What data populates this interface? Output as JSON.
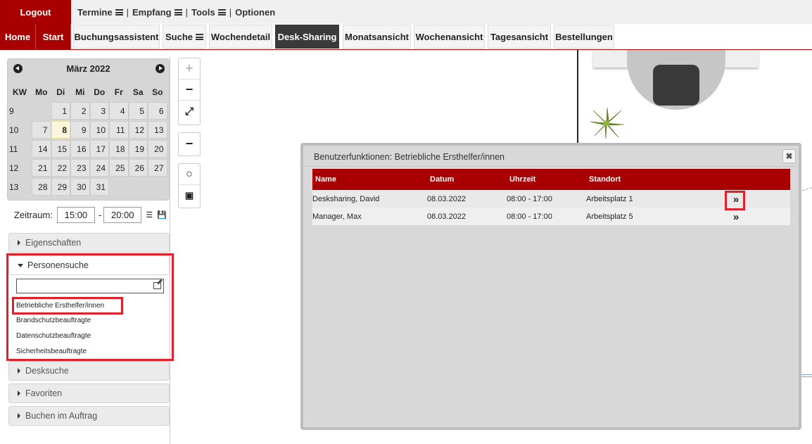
{
  "topbar": {
    "logout": "Logout",
    "menu": [
      {
        "label": "Termine"
      },
      {
        "label": "Empfang"
      },
      {
        "label": "Tools"
      },
      {
        "label": "Optionen"
      }
    ],
    "separator": "|"
  },
  "nav": {
    "home": "Home",
    "start": "Start",
    "tabs": [
      "Buchungsassistent",
      "Suche",
      "Wochendetail",
      "Desk-Sharing",
      "Monatsansicht",
      "Wochenansicht",
      "Tagesansicht",
      "Bestellungen"
    ],
    "active_tab": "Desk-Sharing"
  },
  "calendar": {
    "month_title": "März 2022",
    "headers": [
      "KW",
      "Mo",
      "Di",
      "Mi",
      "Do",
      "Fr",
      "Sa",
      "So"
    ],
    "weeks": [
      {
        "kw": "9",
        "days": [
          "",
          "1",
          "2",
          "3",
          "4",
          "5",
          "6"
        ]
      },
      {
        "kw": "10",
        "days": [
          "7",
          "8",
          "9",
          "10",
          "11",
          "12",
          "13"
        ]
      },
      {
        "kw": "11",
        "days": [
          "14",
          "15",
          "16",
          "17",
          "18",
          "19",
          "20"
        ]
      },
      {
        "kw": "12",
        "days": [
          "21",
          "22",
          "23",
          "24",
          "25",
          "26",
          "27"
        ]
      },
      {
        "kw": "13",
        "days": [
          "28",
          "29",
          "30",
          "31",
          "",
          "",
          ""
        ]
      }
    ],
    "today": "8"
  },
  "zeitraum": {
    "label": "Zeitraum:",
    "from": "15:00",
    "to": "20:00",
    "dash": "-"
  },
  "sidebar": {
    "eigenschaften": "Eigenschaften",
    "personensuche": "Personensuche",
    "person_links": [
      "Betriebliche Ersthelfer/innen",
      "Brandschutzbeauftragte",
      "Datenschutzbeauftragte",
      "Sicherheitsbeauftragte"
    ],
    "desksuche": "Desksuche",
    "favoriten": "Favoriten",
    "buchen_im_auftrag": "Buchen im Auftrag"
  },
  "dialog": {
    "title": "Benutzerfunktionen: Betriebliche Ersthelfer/innen",
    "close": "✖",
    "columns": [
      "Name",
      "Datum",
      "Uhrzeit",
      "Standort"
    ],
    "rows": [
      {
        "name": "Desksharing, David",
        "datum": "08.03.2022",
        "uhrzeit": "08:00 - 17:00",
        "standort": "Arbeitsplatz 1",
        "action": "»"
      },
      {
        "name": "Manager, Max",
        "datum": "08.03.2022",
        "uhrzeit": "08:00 - 17:00",
        "standort": "Arbeitsplatz 5",
        "action": "»"
      }
    ]
  },
  "map_tools": {
    "zoom_in": "+",
    "zoom_out": "−",
    "fit": "⤢",
    "minus": "−",
    "circle": "○",
    "person": "▣"
  },
  "colors": {
    "brand_red": "#a80000",
    "highlight_red": "#e0202a",
    "active_tab": "#3a3a3a"
  }
}
